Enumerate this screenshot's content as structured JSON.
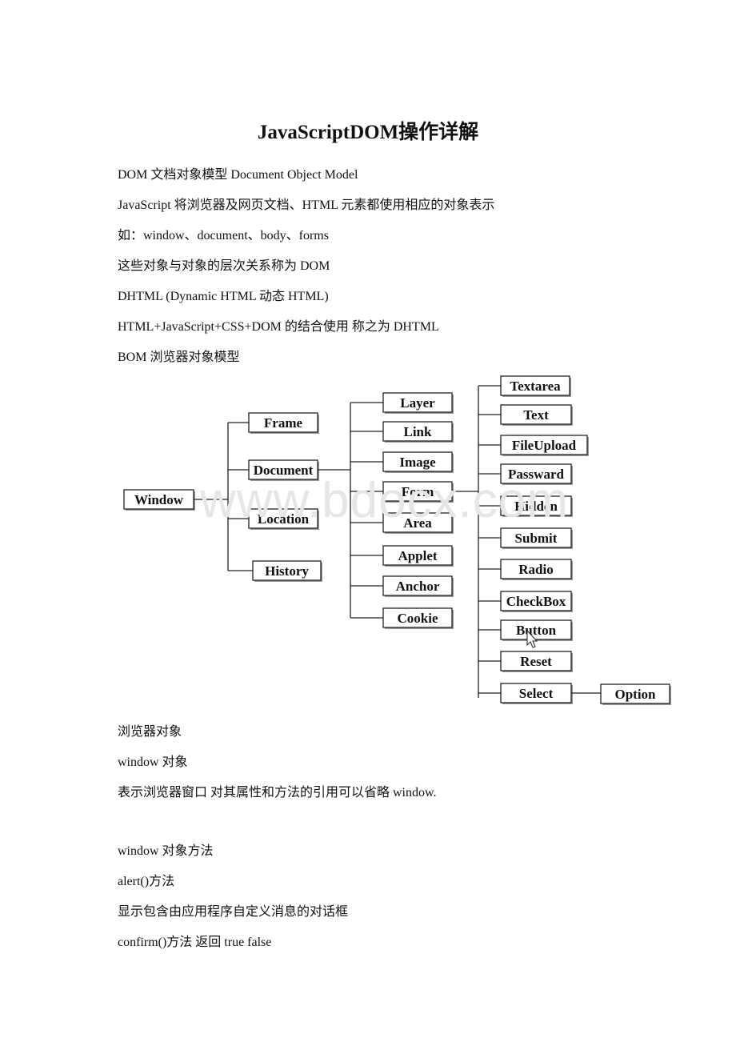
{
  "document": {
    "title": "JavaScriptDOM操作详解",
    "lines_top": [
      "DOM 文档对象模型 Document Object Model",
      " JavaScript 将浏览器及网页文档、HTML 元素都使用相应的对象表示",
      "如：window、document、body、forms",
      "这些对象与对象的层次关系称为 DOM",
      "DHTML (Dynamic HTML 动态 HTML)",
      " HTML+JavaScript+CSS+DOM 的结合使用 称之为 DHTML",
      "BOM 浏览器对象模型"
    ],
    "lines_bottom": [
      "浏览器对象",
      "window 对象",
      "表示浏览器窗口 对其属性和方法的引用可以省略 window.",
      "window 对象方法",
      " alert()方法",
      "显示包含由应用程序自定义消息的对话框",
      " confirm()方法 返回 true false"
    ],
    "watermark": "www.bdocx.com"
  },
  "diagram": {
    "root": "Window",
    "level1": [
      "Frame",
      "Document",
      "Location",
      "History"
    ],
    "document_children": [
      "Layer",
      "Link",
      "Image",
      "Form",
      "Area",
      "Applet",
      "Anchor",
      "Cookie"
    ],
    "form_children": [
      "Textarea",
      "Text",
      "FileUpload",
      "Passward",
      "Hidden",
      "Submit",
      "Radio",
      "CheckBox",
      "Button",
      "Reset",
      "Select"
    ],
    "select_children": [
      "Option"
    ]
  }
}
